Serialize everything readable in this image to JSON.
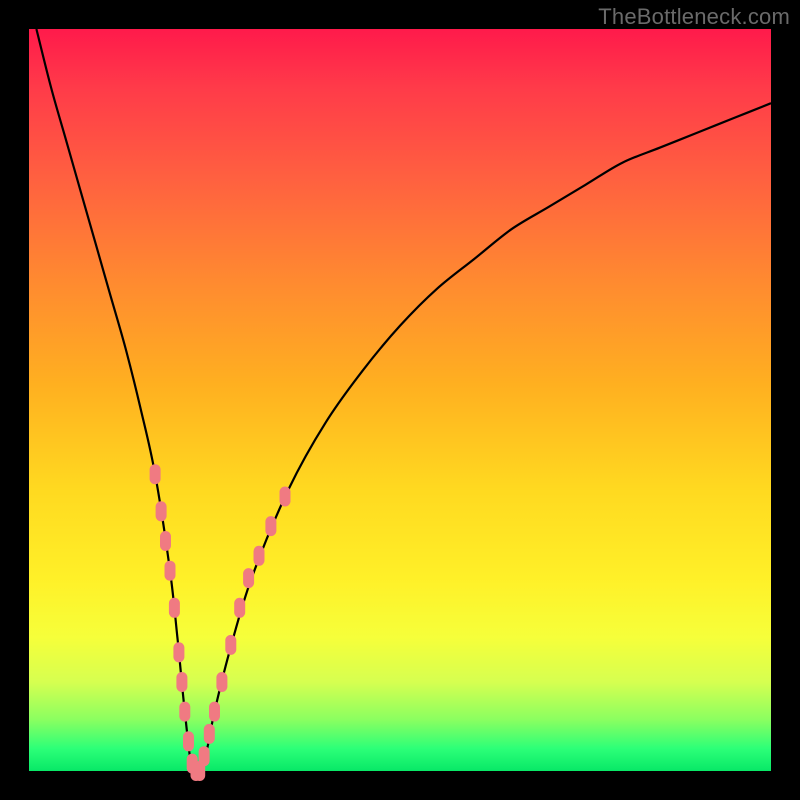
{
  "watermark": "TheBottleneck.com",
  "chart_data": {
    "type": "line",
    "title": "",
    "xlabel": "",
    "ylabel": "",
    "xlim": [
      0,
      100
    ],
    "ylim": [
      0,
      100
    ],
    "grid": false,
    "series": [
      {
        "name": "bottleneck-curve",
        "x": [
          1,
          3,
          5,
          7,
          9,
          11,
          13,
          15,
          17,
          19,
          20,
          21,
          22,
          23,
          24,
          25,
          27,
          30,
          35,
          40,
          45,
          50,
          55,
          60,
          65,
          70,
          75,
          80,
          85,
          90,
          95,
          100
        ],
        "values": [
          100,
          92,
          85,
          78,
          71,
          64,
          57,
          49,
          40,
          27,
          18,
          8,
          0,
          0,
          3,
          8,
          16,
          26,
          38,
          47,
          54,
          60,
          65,
          69,
          73,
          76,
          79,
          82,
          84,
          86,
          88,
          90
        ]
      }
    ],
    "markers": {
      "name": "highlighted-points",
      "color": "#f07a82",
      "points": [
        {
          "x": 17.0,
          "y": 40
        },
        {
          "x": 17.8,
          "y": 35
        },
        {
          "x": 18.4,
          "y": 31
        },
        {
          "x": 19.0,
          "y": 27
        },
        {
          "x": 19.6,
          "y": 22
        },
        {
          "x": 20.2,
          "y": 16
        },
        {
          "x": 20.6,
          "y": 12
        },
        {
          "x": 21.0,
          "y": 8
        },
        {
          "x": 21.5,
          "y": 4
        },
        {
          "x": 22.0,
          "y": 1
        },
        {
          "x": 22.5,
          "y": 0
        },
        {
          "x": 23.0,
          "y": 0
        },
        {
          "x": 23.6,
          "y": 2
        },
        {
          "x": 24.3,
          "y": 5
        },
        {
          "x": 25.0,
          "y": 8
        },
        {
          "x": 26.0,
          "y": 12
        },
        {
          "x": 27.2,
          "y": 17
        },
        {
          "x": 28.4,
          "y": 22
        },
        {
          "x": 29.6,
          "y": 26
        },
        {
          "x": 31.0,
          "y": 29
        },
        {
          "x": 32.6,
          "y": 33
        },
        {
          "x": 34.5,
          "y": 37
        }
      ]
    },
    "gradient_stops": [
      {
        "pos": 0,
        "color": "#ff1a4b"
      },
      {
        "pos": 8,
        "color": "#ff3b49"
      },
      {
        "pos": 20,
        "color": "#ff6040"
      },
      {
        "pos": 34,
        "color": "#ff8a30"
      },
      {
        "pos": 48,
        "color": "#ffb020"
      },
      {
        "pos": 62,
        "color": "#ffd920"
      },
      {
        "pos": 74,
        "color": "#fff028"
      },
      {
        "pos": 82,
        "color": "#f6ff3a"
      },
      {
        "pos": 88,
        "color": "#d6ff50"
      },
      {
        "pos": 93,
        "color": "#8cff60"
      },
      {
        "pos": 97,
        "color": "#2cff78"
      },
      {
        "pos": 100,
        "color": "#08e867"
      }
    ]
  }
}
